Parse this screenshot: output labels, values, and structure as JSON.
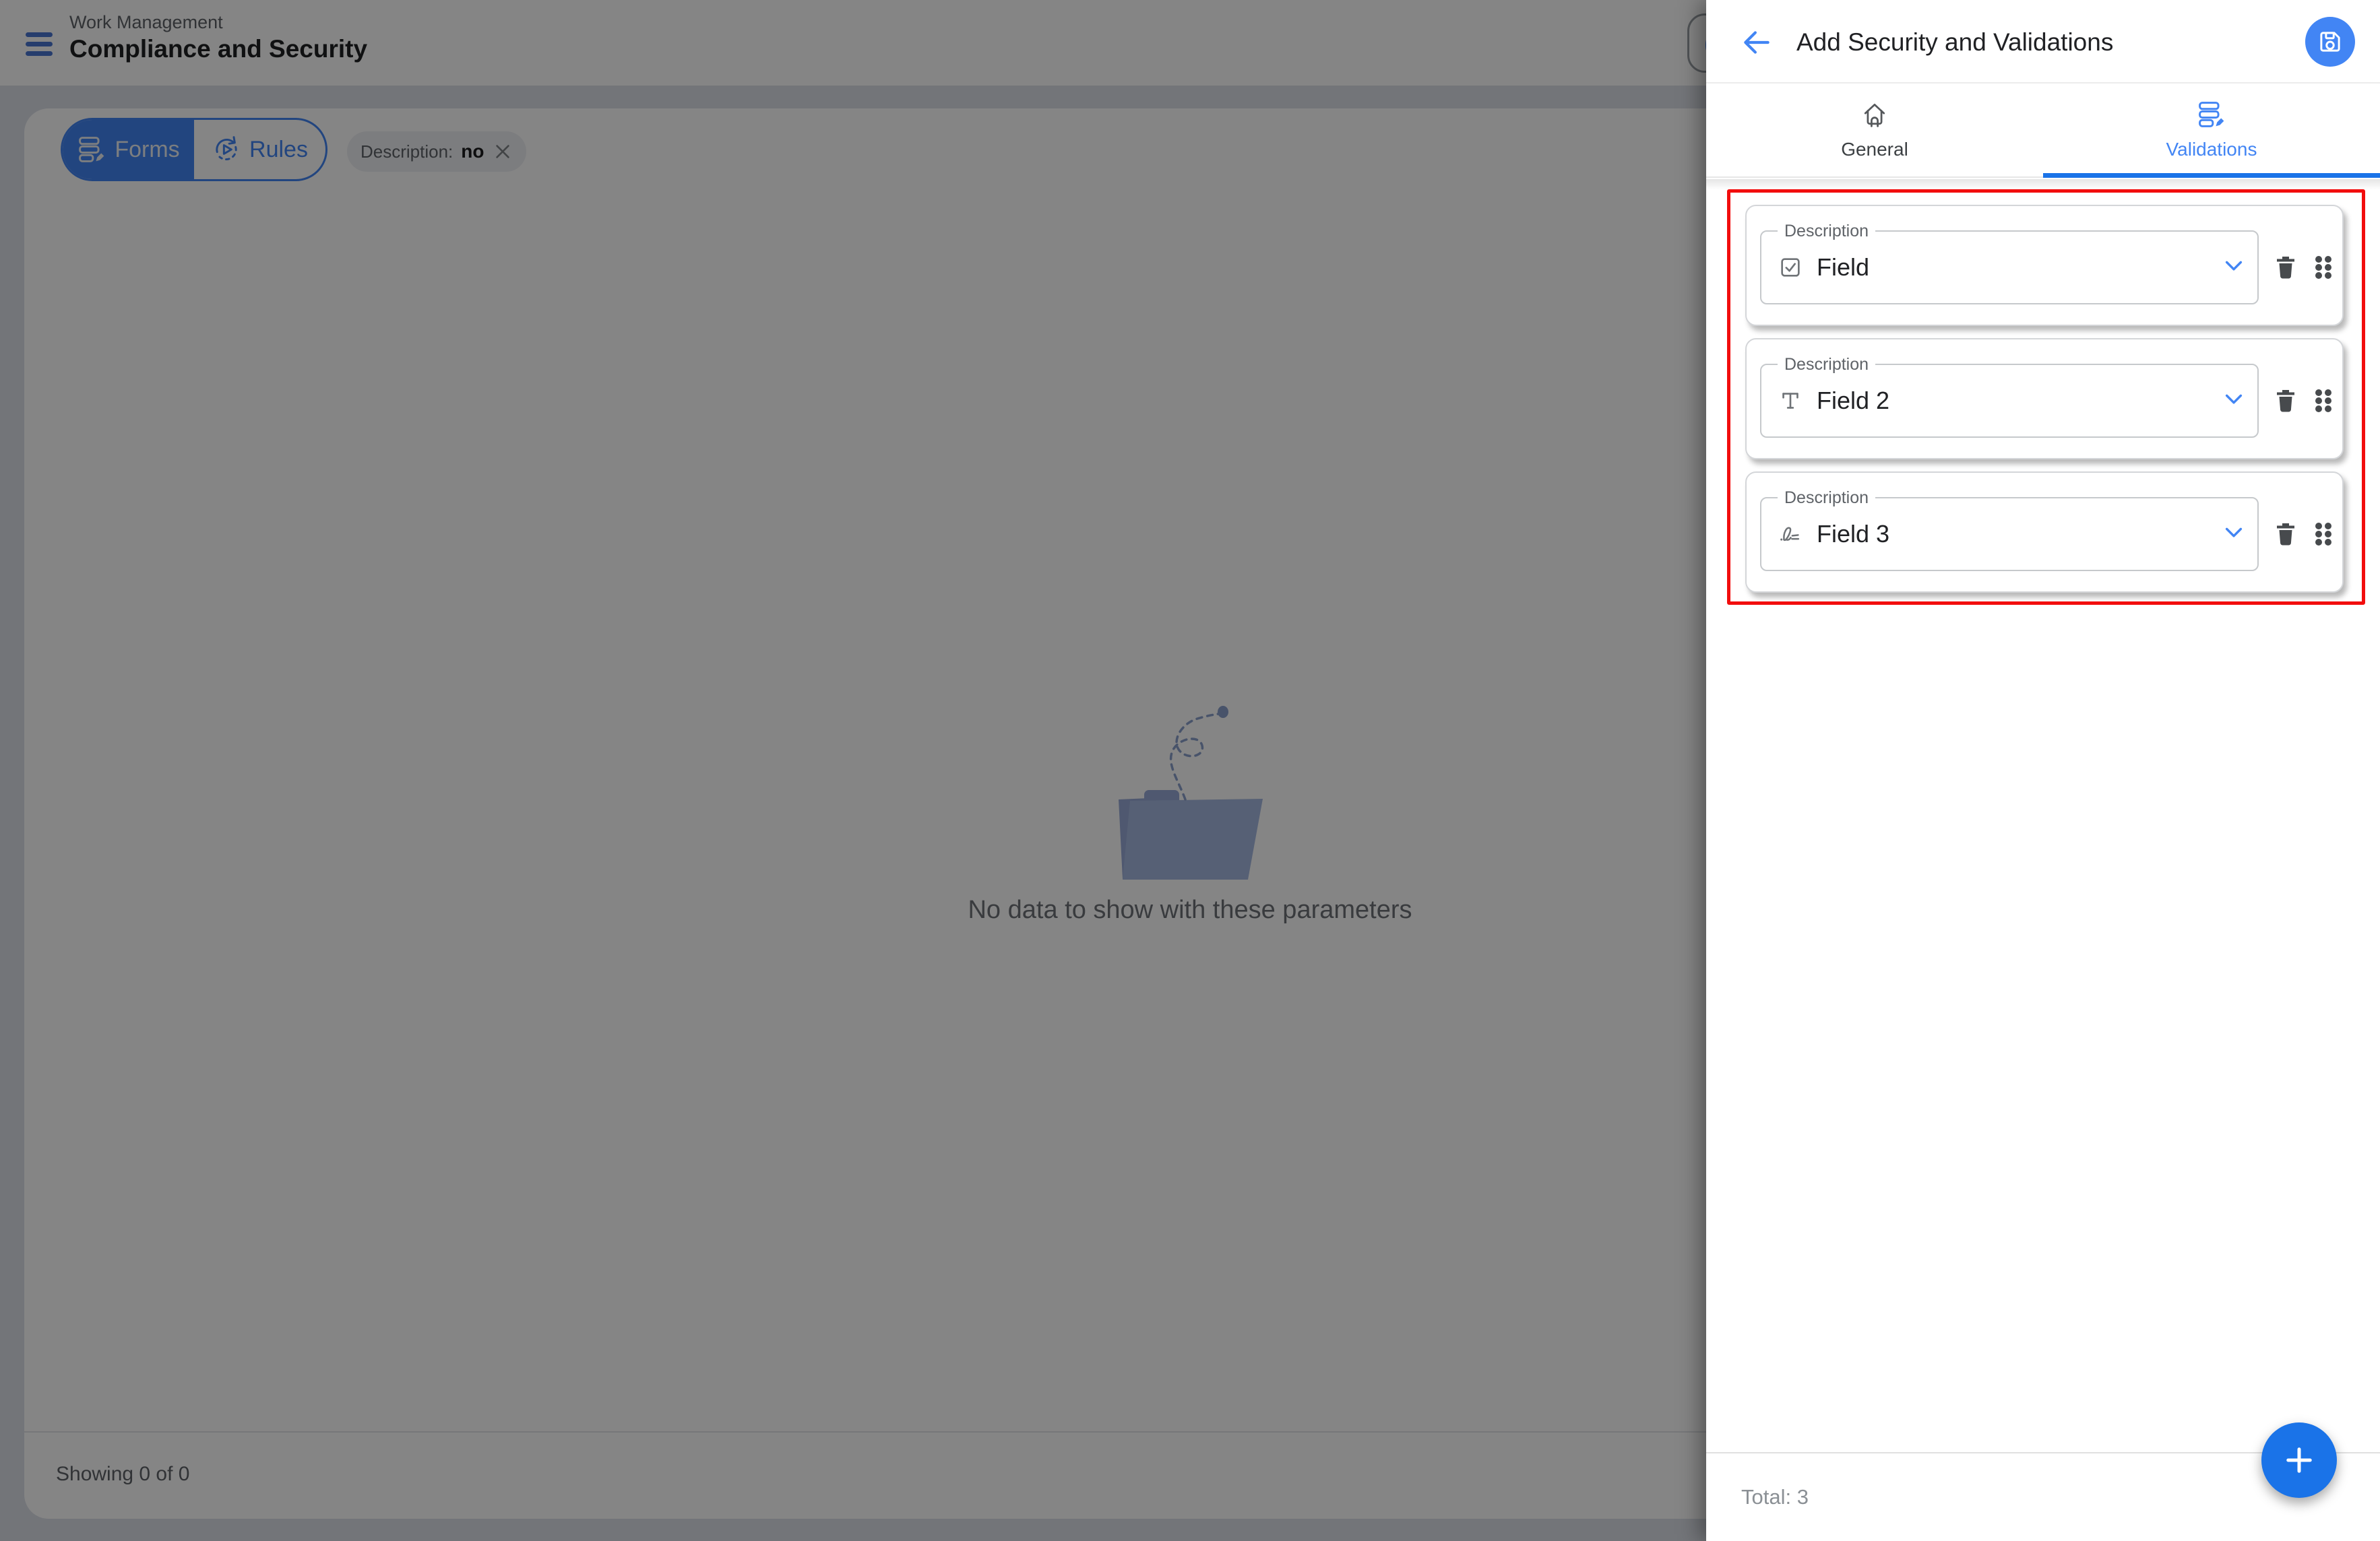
{
  "topbar": {
    "breadcrumb": "Work Management",
    "title": "Compliance and Security"
  },
  "main": {
    "toggle": {
      "forms": "Forms",
      "rules": "Rules"
    },
    "filter_chip": {
      "label": "Description:",
      "value": "no"
    },
    "empty_state_message": "No data to show with these parameters",
    "results_count": "Showing 0 of 0"
  },
  "drawer": {
    "title": "Add Security and Validations",
    "tabs": {
      "general": "General",
      "validations": "Validations"
    },
    "fields": [
      {
        "label": "Description",
        "value": "Field",
        "icon": "checkbox-icon"
      },
      {
        "label": "Description",
        "value": "Field 2",
        "icon": "text-format-icon"
      },
      {
        "label": "Description",
        "value": "Field 3",
        "icon": "signature-icon"
      }
    ],
    "total": "Total: 3"
  },
  "colors": {
    "brand_blue": "#4285f4",
    "fab_blue": "#1a73e8",
    "annotation_red": "#f20d0d"
  }
}
